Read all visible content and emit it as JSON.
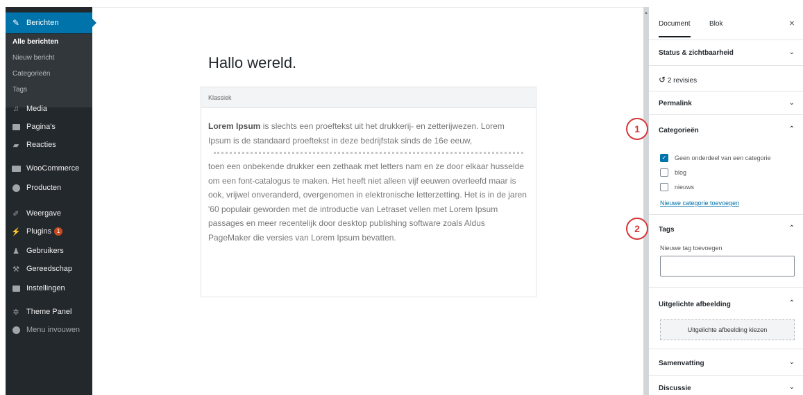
{
  "sidebar": {
    "active": {
      "label": "Berichten",
      "icon": "pin-icon"
    },
    "submenu": [
      "Alle berichten",
      "Nieuw bericht",
      "Categorieën",
      "Tags"
    ],
    "items": [
      {
        "label": "Media",
        "icon": "media-icon"
      },
      {
        "label": "Pagina's",
        "icon": "pages-icon"
      },
      {
        "label": "Reacties",
        "icon": "comments-icon"
      },
      {
        "label": "WooCommerce",
        "icon": "woocommerce-icon"
      },
      {
        "label": "Producten",
        "icon": "products-icon"
      },
      {
        "label": "Weergave",
        "icon": "appearance-icon"
      },
      {
        "label": "Plugins",
        "icon": "plugins-icon",
        "badge": "1"
      },
      {
        "label": "Gebruikers",
        "icon": "users-icon"
      },
      {
        "label": "Gereedschap",
        "icon": "tools-icon"
      },
      {
        "label": "Instellingen",
        "icon": "settings-icon"
      },
      {
        "label": "Theme Panel",
        "icon": "gear-icon"
      },
      {
        "label": "Menu invouwen",
        "icon": "collapse-icon"
      }
    ]
  },
  "editor": {
    "post_title": "Hallo wereld.",
    "classic_label": "Klassiek",
    "para1_bold": "Lorem Ipsum",
    "para1_rest": " is slechts een proeftekst uit het drukkerij- en zetterijwezen. Lorem Ipsum is de standaard proeftekst in deze bedrijfstak sinds de 16e eeuw,",
    "para2": "toen een onbekende drukker een zethaak met letters nam en ze door elkaar husselde om een font-catalogus te maken. Het heeft niet alleen vijf eeuwen overleefd maar is ook, vrijwel onveranderd, overgenomen in elektronische letterzetting. Het is in de jaren '60 populair geworden met de introductie van Letraset vellen met Lorem Ipsum passages en meer recentelijk door desktop publishing software zoals Aldus PageMaker die versies van Lorem Ipsum bevatten."
  },
  "panel": {
    "tabs": [
      "Document",
      "Blok"
    ],
    "close": "×",
    "status": "Status & zichtbaarheid",
    "revisions": "2 revisies",
    "permalink": "Permalink",
    "categories": {
      "title": "Categorieën",
      "options": [
        {
          "label": "Geen onderdeel van een categorie",
          "checked": true
        },
        {
          "label": "blog",
          "checked": false
        },
        {
          "label": "nieuws",
          "checked": false
        }
      ],
      "add_link": "Nieuwe categorie toevoegen"
    },
    "tags": {
      "title": "Tags",
      "label": "Nieuwe tag toevoegen",
      "value": ""
    },
    "featured": {
      "title": "Uitgelichte afbeelding",
      "button": "Uitgelichte afbeelding kiezen"
    },
    "excerpt": "Samenvatting",
    "discussion": "Discussie"
  },
  "callouts": [
    "1",
    "2"
  ],
  "colors": {
    "accent": "#0073aa",
    "sidebar": "#23282d",
    "callout": "#d63638",
    "badge": "#ca4a1f"
  }
}
